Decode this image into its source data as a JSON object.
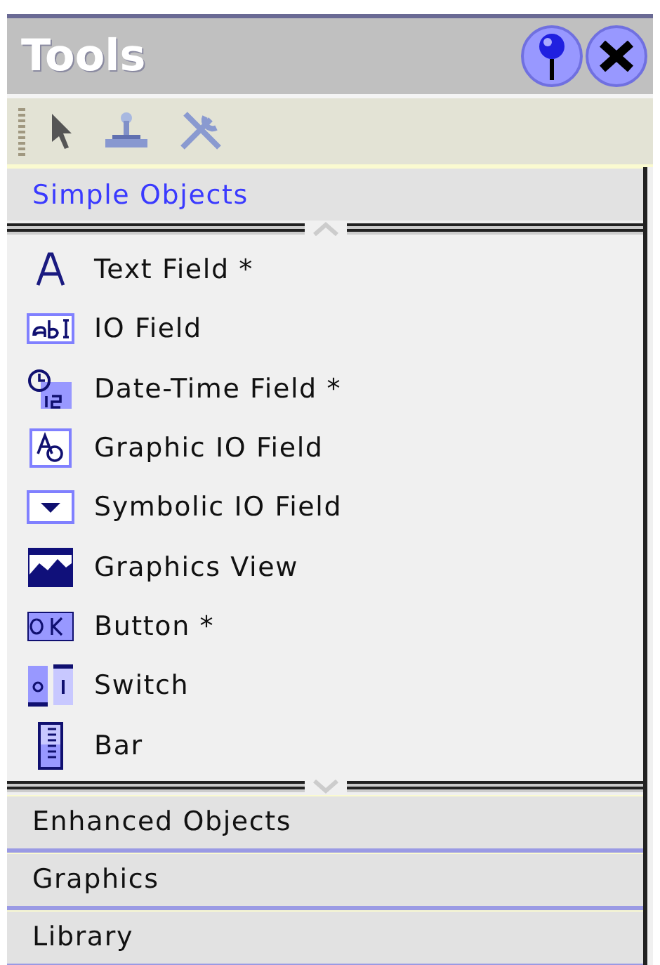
{
  "window": {
    "title": "Tools"
  },
  "sections": [
    {
      "label": "Simple Objects",
      "selected": true,
      "items": [
        {
          "label": "Text Field *"
        },
        {
          "label": "IO Field"
        },
        {
          "label": "Date-Time Field *"
        },
        {
          "label": "Graphic IO Field"
        },
        {
          "label": "Symbolic IO Field"
        },
        {
          "label": "Graphics View"
        },
        {
          "label": "Button *"
        },
        {
          "label": "Switch"
        },
        {
          "label": "Bar"
        }
      ]
    },
    {
      "label": "Enhanced Objects",
      "selected": false
    },
    {
      "label": "Graphics",
      "selected": false
    },
    {
      "label": "Library",
      "selected": false
    }
  ]
}
